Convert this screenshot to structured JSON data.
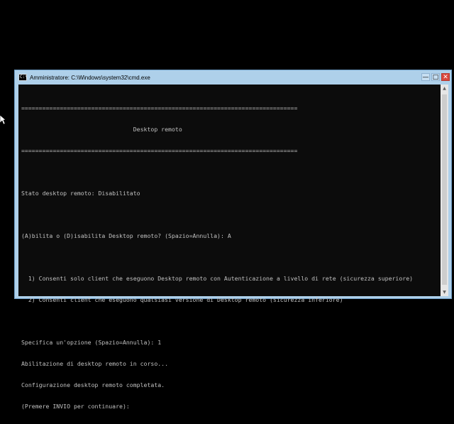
{
  "window": {
    "title": "Amministratore: C:\\Windows\\system32\\cmd.exe",
    "icon": "cmd-icon",
    "buttons": {
      "minimize": "—",
      "maximize": "□",
      "close": "✕"
    }
  },
  "console": {
    "lines": [
      "===============================================================================",
      "                                Desktop remoto",
      "===============================================================================",
      "",
      "Stato desktop remoto: Disabilitato",
      "",
      "(A)bilita o (D)isabilita Desktop remoto? (Spazio=Annulla): A",
      "",
      "  1) Consenti solo client che eseguono Desktop remoto con Autenticazione a livello di rete (sicurezza superiore)",
      "  2) Consenti client che eseguono qualsiasi versione di Desktop remoto (sicurezza inferiore)",
      "",
      "Specifica un'opzione (Spazio=Annulla): 1",
      "Abilitazione di desktop remoto in corso...",
      "Configurazione desktop remoto completata.",
      "(Premere INVIO per continuare):"
    ]
  },
  "colors": {
    "console_bg": "#0c0c0c",
    "console_text": "#c0c0c0",
    "frame": "#aed0ea",
    "close_button": "#d9453b"
  }
}
